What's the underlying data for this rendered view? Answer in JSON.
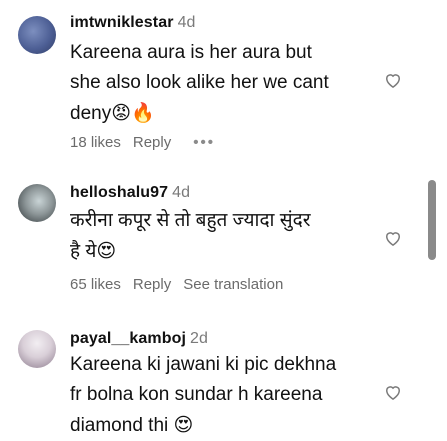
{
  "comments": [
    {
      "username": "imtwniklestar",
      "time": "4d",
      "text": "Kareena aura is her aura but\nshe also look alike her we cant\ndeny",
      "emojis": "😡🔥",
      "likes": "18 likes",
      "reply_label": "Reply",
      "more_label": "•••"
    },
    {
      "username": "helloshalu97",
      "time": "4d",
      "text": "करीना कपूर से तो बहुत ज्यादा सुंदर\nहै ये",
      "emojis": "😍",
      "likes": "65 likes",
      "reply_label": "Reply",
      "translate_label": "See translation"
    },
    {
      "username": "payal__kamboj",
      "time": "2d",
      "text": "Kareena ki jawani ki pic dekhna\nfr bolna kon sundar h kareena\ndiamond thi",
      "emojis": "😍"
    }
  ],
  "icons": {
    "like": "heart-outline-icon",
    "avatar1": "avatar",
    "avatar2": "avatar",
    "avatar3": "avatar"
  },
  "colors": {
    "secondary_text": "#6b6b6b",
    "scrollbar": "#8a8a8a"
  }
}
